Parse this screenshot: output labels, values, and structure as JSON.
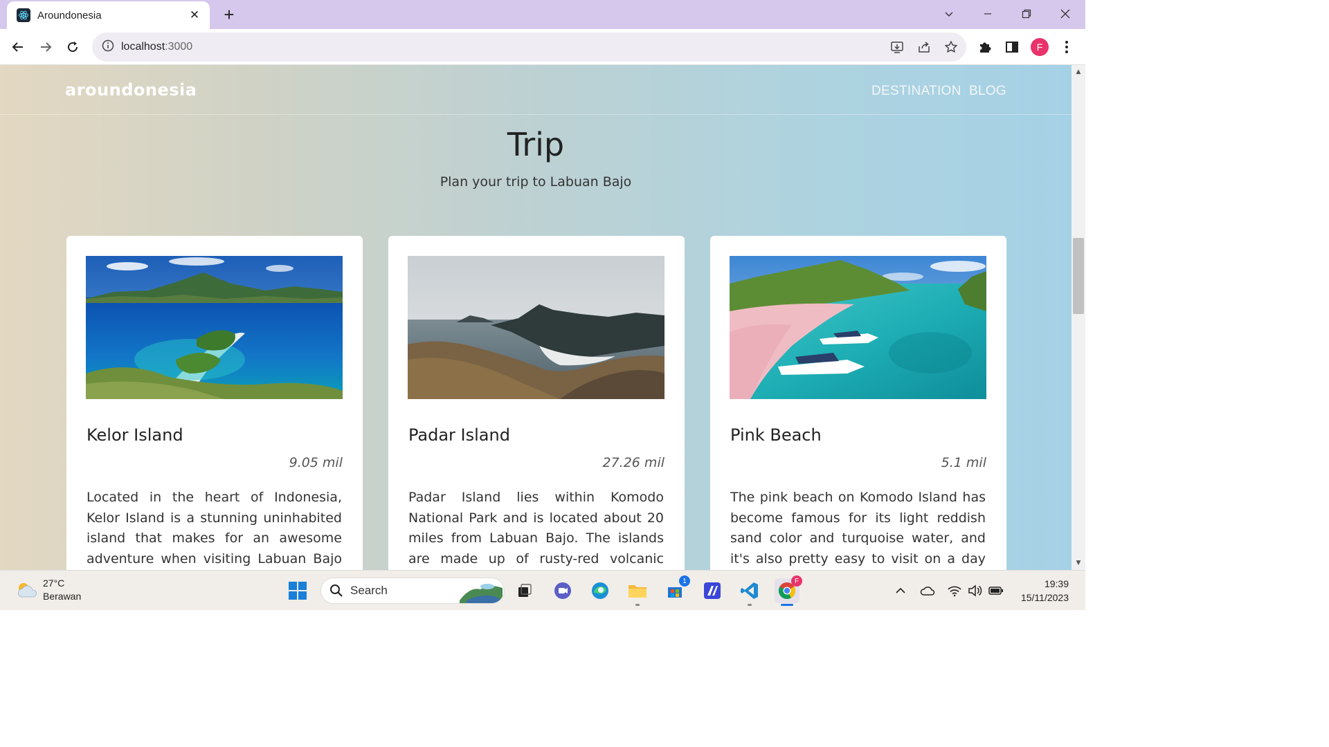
{
  "browser": {
    "tab_title": "Aroundonesia",
    "new_tab": "+",
    "url_host": "localhost",
    "url_port": ":3000",
    "profile_initial": "F"
  },
  "site": {
    "logo": "aroundonesia",
    "nav": [
      "DESTINATION",
      "BLOG"
    ],
    "title": "Trip",
    "subtitle": "Plan your trip to Labuan Bajo"
  },
  "cards": [
    {
      "name": "Kelor Island",
      "distance": "9.05 mil",
      "description": "Located in the heart of Indonesia, Kelor Island is a stunning uninhabited island that makes for an awesome adventure when visiting Labuan Bajo in Flores. There"
    },
    {
      "name": "Padar Island",
      "distance": "27.26 mil",
      "description": "Padar Island lies within Komodo National Park and is located about 20 miles from Labuan Bajo. The islands are made up of rusty-red volcanic hills, savannahs on land,"
    },
    {
      "name": "Pink Beach",
      "distance": "5.1 mil",
      "description": "The pink beach on Komodo Island has become famous for its light reddish sand color and turquoise water, and it's also pretty easy to visit on a day trip from the"
    }
  ],
  "taskbar": {
    "weather_temp": "27°C",
    "weather_desc": "Berawan",
    "search_placeholder": "Search",
    "store_badge": "1",
    "time": "19:39",
    "date": "15/11/2023"
  },
  "colors": {
    "tabbar": "#d6c8ec",
    "profile": "#e8336b",
    "accent": "#1a73e8"
  }
}
